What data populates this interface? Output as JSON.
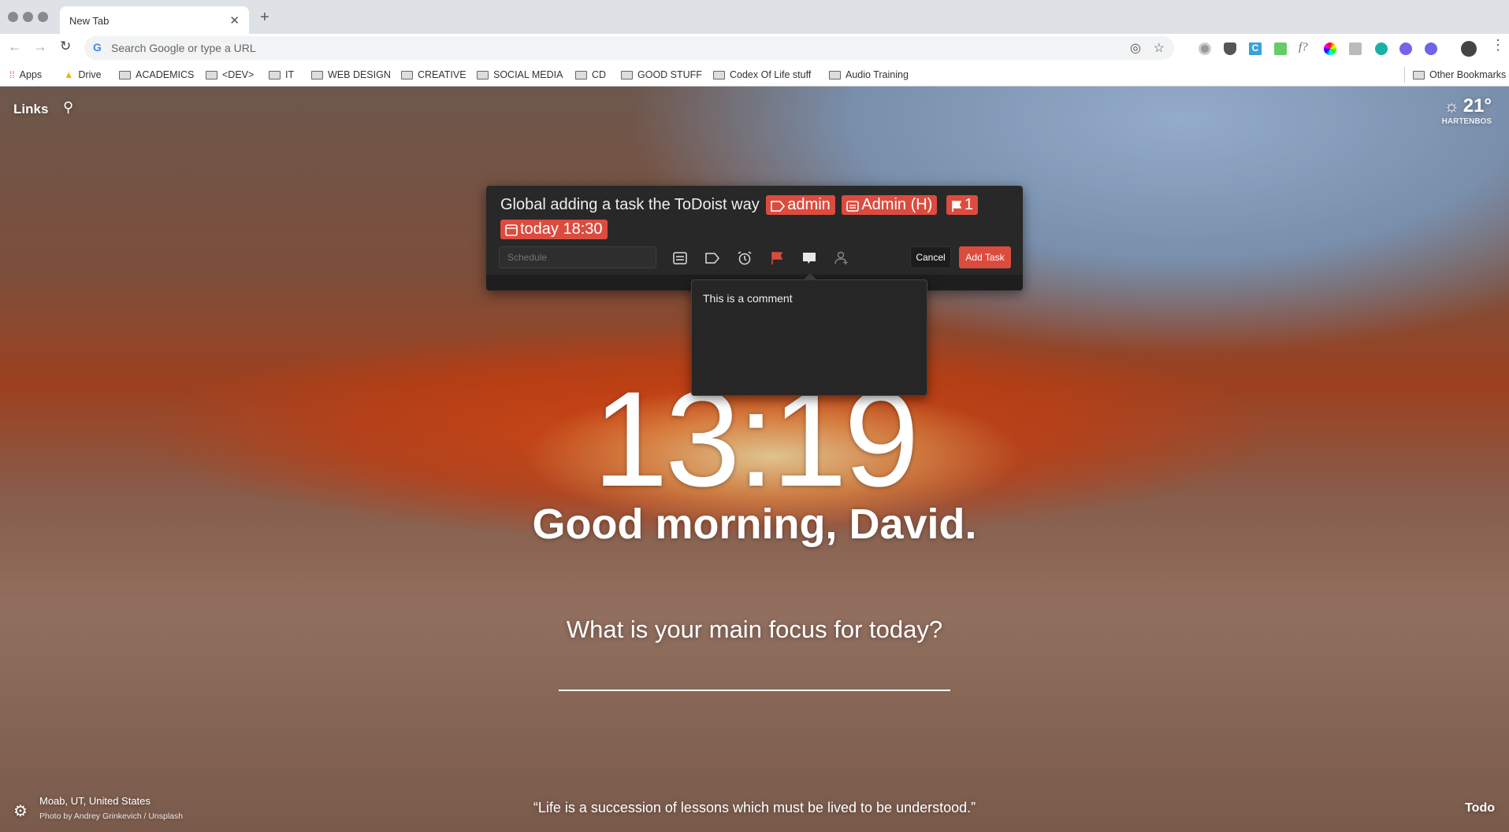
{
  "browser": {
    "tab_title": "New Tab",
    "omnibox_placeholder": "Search Google or type a URL",
    "bookmarks": [
      "Apps",
      "Drive",
      "ACADEMICS",
      "<DEV>",
      "IT",
      "WEB DESIGN",
      "CREATIVE",
      "SOCIAL MEDIA",
      "CD",
      "GOOD STUFF",
      "Codex Of Life stuff",
      "Audio Training"
    ],
    "other_bookmarks": "Other Bookmarks",
    "extension_text_f": "f?"
  },
  "dashboard": {
    "links_label": "Links",
    "weather": {
      "temp": "21°",
      "location": "HARTENBOS",
      "icon": "sun-icon"
    },
    "clock": "13:19",
    "greeting": "Good morning, David.",
    "focus_prompt": "What is your main focus for today?",
    "photo_location": "Moab, UT, United States",
    "photo_credit": "Photo by Andrey Grinkevich / Unsplash",
    "quote": "“Life is a succession of lessons which must be lived to be understood.”",
    "todo_label": "Todo"
  },
  "task_dialog": {
    "task_text": "Global adding a task the ToDoist way",
    "chips": {
      "label": "admin",
      "project": "Admin (H)",
      "priority": "1",
      "due": "today 18:30"
    },
    "schedule_placeholder": "Schedule",
    "cancel_label": "Cancel",
    "add_label": "Add Task",
    "comment": "This is a comment",
    "accent": "#db4c3f"
  }
}
